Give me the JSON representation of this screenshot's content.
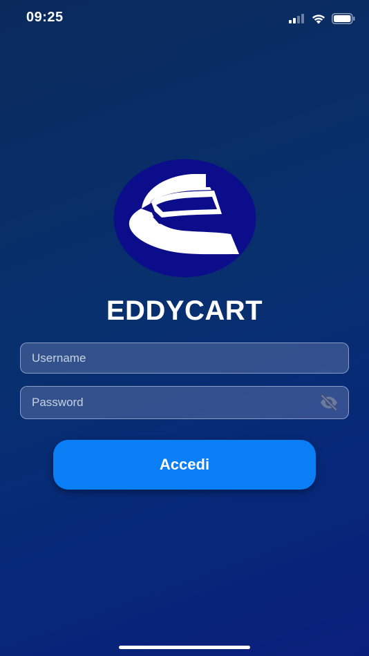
{
  "status_bar": {
    "time": "09:25",
    "icons": [
      "cellular-signal-icon",
      "wifi-icon",
      "battery-icon"
    ]
  },
  "logo": {
    "icon": "eddycart-logo",
    "colors": {
      "circle": "#0c0d8a",
      "mark": "#ffffff"
    }
  },
  "app": {
    "title": "EDDYCART"
  },
  "login_form": {
    "username": {
      "placeholder": "Username",
      "value": ""
    },
    "password": {
      "placeholder": "Password",
      "value": "",
      "toggle_icon": "eye-off-icon"
    },
    "submit_label": "Accedi"
  },
  "colors": {
    "background_top": "#0a2a5c",
    "background_bottom": "#0a1f7a",
    "button": "#0a7ef5",
    "input_fill": "#707fb2"
  }
}
